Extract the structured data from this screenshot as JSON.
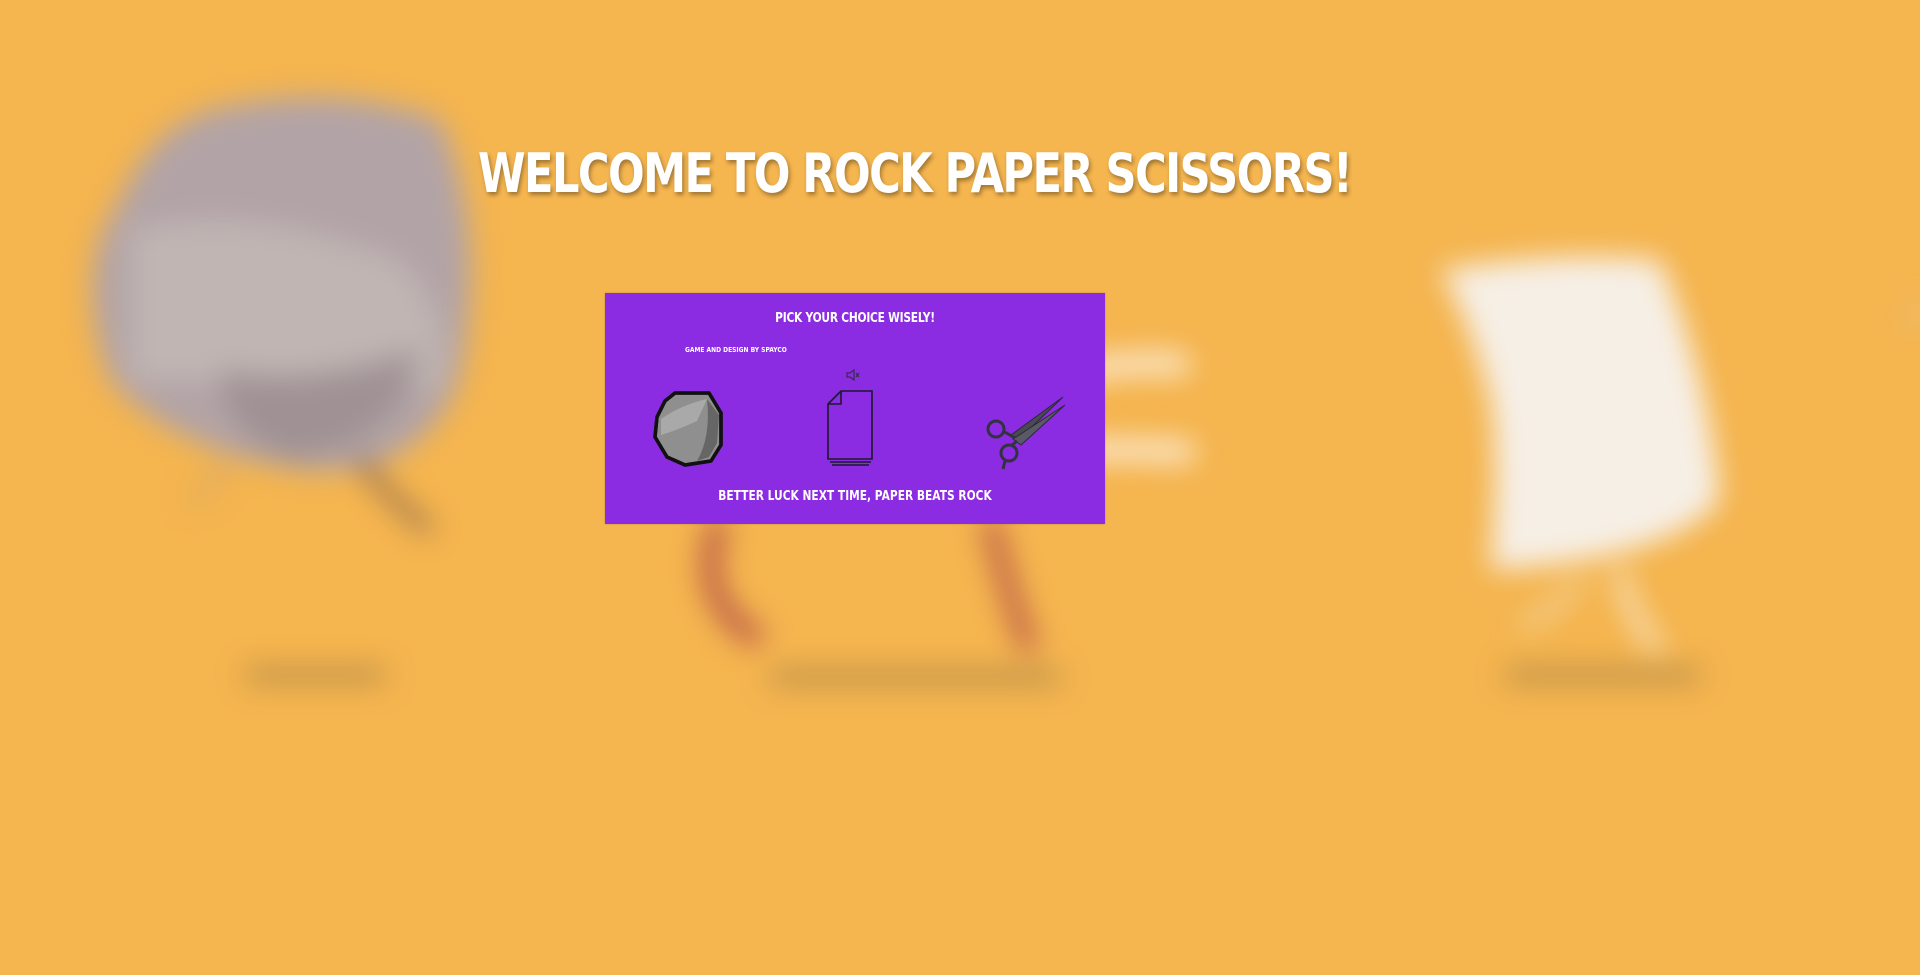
{
  "page": {
    "title": "Welcome to Rock Paper Scissors!",
    "background_color": "#f5b54f"
  },
  "panel": {
    "heading": "Pick your choice wisely!",
    "credit": "Game and design by Spayco",
    "background_color": "#8b2be2",
    "sound_icon": "speaker-mute-icon",
    "choices": [
      {
        "name": "rock",
        "icon": "rock-icon"
      },
      {
        "name": "paper",
        "icon": "paper-icon"
      },
      {
        "name": "scissors",
        "icon": "scissors-icon"
      }
    ],
    "result": "Better luck next time, paper beats rock"
  }
}
